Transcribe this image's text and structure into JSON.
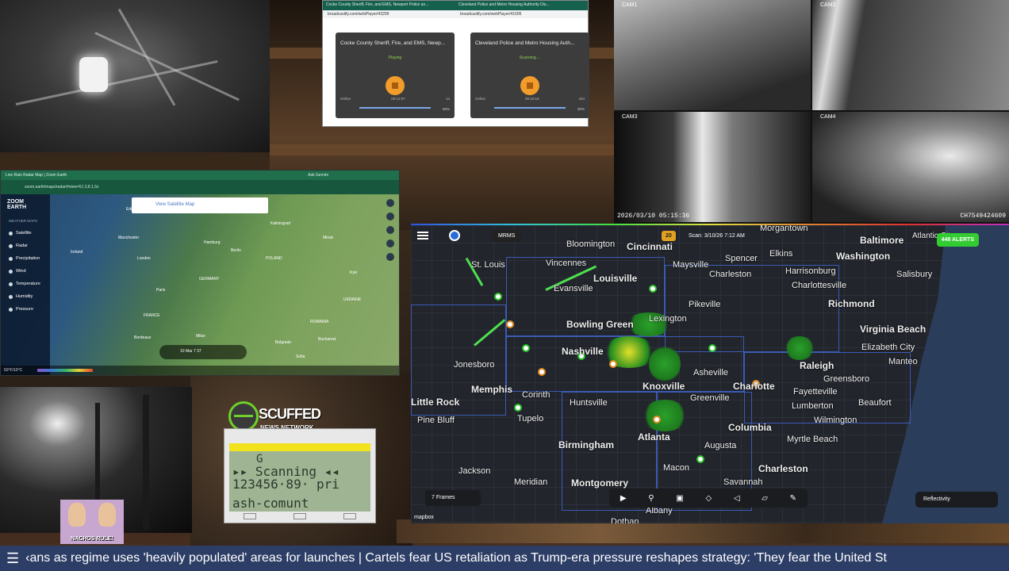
{
  "radio": {
    "tab1": "Cocke County Sheriff, Fire, and EMS, Newport Police an...",
    "tab2": "Cleveland Police and Metro Housing Authority Dis...",
    "url1": "broadcastify.com/webPlayer/43299",
    "url2": "broadcastify.com/webPlayer/41005",
    "player1": {
      "title": "Cocke County Sheriff, Fire, and EMS, Newp...",
      "status": "Playing",
      "state": "Online",
      "time": "00:12:07",
      "listeners": "14",
      "volume": "60%"
    },
    "player2": {
      "title": "Cleveland Police and Metro Housing Auth...",
      "status": "Scanning ...",
      "state": "Online",
      "time": "00:10:18",
      "listeners": "434",
      "volume": "30%"
    }
  },
  "cams": {
    "cam1": "CAM1",
    "cam2": "CAM2",
    "cam3": "CAM3",
    "cam4": "CAM4",
    "stamp_left": "2026/03/10  05:15:36",
    "stamp_right": "CH7549424609"
  },
  "zoom_earth": {
    "tab": "Live Rain Radar Map | Zoom Earth",
    "tab2": "Ask Gemini",
    "url": "zoom.earth/maps/radar/#view=51.3,8.1,5z",
    "logo": "ZOOM EARTH",
    "menu_header": "WEATHER MAPS",
    "items": [
      "Satellite",
      "Radar",
      "Precipitation",
      "Wind",
      "Temperature",
      "Humidity",
      "Pressure"
    ],
    "banner": "View Satellite Map",
    "places": [
      "Edinburgh",
      "Ireland",
      "Manchester",
      "London",
      "Hamburg",
      "Berlin",
      "POLAND",
      "GERMANY",
      "FRANCE",
      "Bordeaux",
      "Milan",
      "Belgrade",
      "Kaliningrad",
      "Minsk",
      "Kyiv",
      "UKRAINE",
      "ROMANIA",
      "Bucharest",
      "Sofia",
      "Paris"
    ],
    "timeline": "10 Mar   7   37",
    "legend": "50°F/10°C"
  },
  "radar": {
    "source": "MRMS",
    "badge": "20",
    "scan": "Scan: 3/10/26 7:12 AM",
    "alerts": "448 ALERTS",
    "frames": "7 Frames",
    "layer": "Reflectivity",
    "attribution": "mapbox",
    "cities": [
      {
        "name": "Bloomington",
        "big": true
      },
      {
        "name": "Cincinnati",
        "big": true
      },
      {
        "name": "Baltimore",
        "big": true
      },
      {
        "name": "Washington",
        "big": true
      },
      {
        "name": "St. Louis",
        "big": false
      },
      {
        "name": "Vincennes",
        "big": false
      },
      {
        "name": "Louisville",
        "big": true
      },
      {
        "name": "Maysville",
        "big": false
      },
      {
        "name": "Elkins",
        "big": false
      },
      {
        "name": "Spencer",
        "big": false
      },
      {
        "name": "Charleston",
        "big": false
      },
      {
        "name": "Harrisonburg",
        "big": false
      },
      {
        "name": "Charlottesville",
        "big": false
      },
      {
        "name": "Richmond",
        "big": true
      },
      {
        "name": "Salisbury",
        "big": false
      },
      {
        "name": "Virginia Beach",
        "big": true
      },
      {
        "name": "Elizabeth City",
        "big": false
      },
      {
        "name": "Raleigh",
        "big": true
      },
      {
        "name": "Nashville",
        "big": true
      },
      {
        "name": "Memphis",
        "big": true
      },
      {
        "name": "Bowling Green",
        "big": true
      },
      {
        "name": "Knoxville",
        "big": true
      },
      {
        "name": "Asheville",
        "big": false
      },
      {
        "name": "Charlotte",
        "big": true
      },
      {
        "name": "Greenville",
        "big": false
      },
      {
        "name": "Atlanta",
        "big": true
      },
      {
        "name": "Birmingham",
        "big": true
      },
      {
        "name": "Huntsville",
        "big": false
      },
      {
        "name": "Columbia",
        "big": true
      },
      {
        "name": "Augusta",
        "big": false
      },
      {
        "name": "Macon",
        "big": false
      },
      {
        "name": "Montgomery",
        "big": true
      },
      {
        "name": "Jackson",
        "big": false
      },
      {
        "name": "Little Rock",
        "big": true
      },
      {
        "name": "Pine Bluff",
        "big": false
      },
      {
        "name": "Tupelo",
        "big": false
      },
      {
        "name": "Wilmington",
        "big": false
      },
      {
        "name": "Myrtle Beach",
        "big": false
      },
      {
        "name": "Charleston",
        "big": true
      },
      {
        "name": "Savannah",
        "big": false
      },
      {
        "name": "Fayetteville",
        "big": false
      },
      {
        "name": "Greensboro",
        "big": false
      },
      {
        "name": "Lumberton",
        "big": false
      },
      {
        "name": "Beaufort",
        "big": false
      },
      {
        "name": "Evansville",
        "big": false
      },
      {
        "name": "Pikeville",
        "big": false
      },
      {
        "name": "Lexington",
        "big": false
      },
      {
        "name": "Jonesboro",
        "big": false
      },
      {
        "name": "Corinth",
        "big": false
      },
      {
        "name": "Meridian",
        "big": false
      },
      {
        "name": "Dothan",
        "big": false
      },
      {
        "name": "Albany",
        "big": false
      },
      {
        "name": "Manteo",
        "big": false
      },
      {
        "name": "Morgantown",
        "big": false
      },
      {
        "name": "Atlantic City",
        "big": false
      }
    ]
  },
  "overlay": {
    "brand_top": "SCUFFED",
    "brand_bottom": "NEWS NETWORK",
    "scanner_line1": "G",
    "scanner_line2": "▸▸ Scanning ◂◂",
    "scanner_line3": "123456·89·  pri",
    "scanner_line4": "ash-comunt",
    "nachos": "NACHOS RULE!"
  },
  "ticker": {
    "text": "‹ans as regime uses 'heavily populated' areas for launches  |   Cartels fear US retaliation as Trump-era pressure reshapes strategy: 'They fear the United St"
  }
}
